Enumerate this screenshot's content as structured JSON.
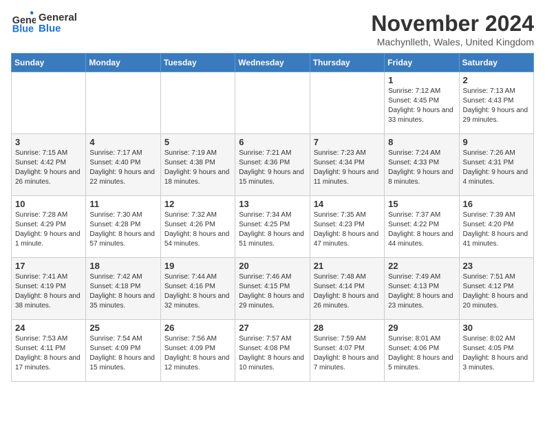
{
  "logo": {
    "line1": "General",
    "line2": "Blue"
  },
  "title": "November 2024",
  "location": "Machynlleth, Wales, United Kingdom",
  "weekdays": [
    "Sunday",
    "Monday",
    "Tuesday",
    "Wednesday",
    "Thursday",
    "Friday",
    "Saturday"
  ],
  "weeks": [
    [
      {
        "day": "",
        "info": ""
      },
      {
        "day": "",
        "info": ""
      },
      {
        "day": "",
        "info": ""
      },
      {
        "day": "",
        "info": ""
      },
      {
        "day": "",
        "info": ""
      },
      {
        "day": "1",
        "info": "Sunrise: 7:12 AM\nSunset: 4:45 PM\nDaylight: 9 hours and 33 minutes."
      },
      {
        "day": "2",
        "info": "Sunrise: 7:13 AM\nSunset: 4:43 PM\nDaylight: 9 hours and 29 minutes."
      }
    ],
    [
      {
        "day": "3",
        "info": "Sunrise: 7:15 AM\nSunset: 4:42 PM\nDaylight: 9 hours and 26 minutes."
      },
      {
        "day": "4",
        "info": "Sunrise: 7:17 AM\nSunset: 4:40 PM\nDaylight: 9 hours and 22 minutes."
      },
      {
        "day": "5",
        "info": "Sunrise: 7:19 AM\nSunset: 4:38 PM\nDaylight: 9 hours and 18 minutes."
      },
      {
        "day": "6",
        "info": "Sunrise: 7:21 AM\nSunset: 4:36 PM\nDaylight: 9 hours and 15 minutes."
      },
      {
        "day": "7",
        "info": "Sunrise: 7:23 AM\nSunset: 4:34 PM\nDaylight: 9 hours and 11 minutes."
      },
      {
        "day": "8",
        "info": "Sunrise: 7:24 AM\nSunset: 4:33 PM\nDaylight: 9 hours and 8 minutes."
      },
      {
        "day": "9",
        "info": "Sunrise: 7:26 AM\nSunset: 4:31 PM\nDaylight: 9 hours and 4 minutes."
      }
    ],
    [
      {
        "day": "10",
        "info": "Sunrise: 7:28 AM\nSunset: 4:29 PM\nDaylight: 9 hours and 1 minute."
      },
      {
        "day": "11",
        "info": "Sunrise: 7:30 AM\nSunset: 4:28 PM\nDaylight: 8 hours and 57 minutes."
      },
      {
        "day": "12",
        "info": "Sunrise: 7:32 AM\nSunset: 4:26 PM\nDaylight: 8 hours and 54 minutes."
      },
      {
        "day": "13",
        "info": "Sunrise: 7:34 AM\nSunset: 4:25 PM\nDaylight: 8 hours and 51 minutes."
      },
      {
        "day": "14",
        "info": "Sunrise: 7:35 AM\nSunset: 4:23 PM\nDaylight: 8 hours and 47 minutes."
      },
      {
        "day": "15",
        "info": "Sunrise: 7:37 AM\nSunset: 4:22 PM\nDaylight: 8 hours and 44 minutes."
      },
      {
        "day": "16",
        "info": "Sunrise: 7:39 AM\nSunset: 4:20 PM\nDaylight: 8 hours and 41 minutes."
      }
    ],
    [
      {
        "day": "17",
        "info": "Sunrise: 7:41 AM\nSunset: 4:19 PM\nDaylight: 8 hours and 38 minutes."
      },
      {
        "day": "18",
        "info": "Sunrise: 7:42 AM\nSunset: 4:18 PM\nDaylight: 8 hours and 35 minutes."
      },
      {
        "day": "19",
        "info": "Sunrise: 7:44 AM\nSunset: 4:16 PM\nDaylight: 8 hours and 32 minutes."
      },
      {
        "day": "20",
        "info": "Sunrise: 7:46 AM\nSunset: 4:15 PM\nDaylight: 8 hours and 29 minutes."
      },
      {
        "day": "21",
        "info": "Sunrise: 7:48 AM\nSunset: 4:14 PM\nDaylight: 8 hours and 26 minutes."
      },
      {
        "day": "22",
        "info": "Sunrise: 7:49 AM\nSunset: 4:13 PM\nDaylight: 8 hours and 23 minutes."
      },
      {
        "day": "23",
        "info": "Sunrise: 7:51 AM\nSunset: 4:12 PM\nDaylight: 8 hours and 20 minutes."
      }
    ],
    [
      {
        "day": "24",
        "info": "Sunrise: 7:53 AM\nSunset: 4:11 PM\nDaylight: 8 hours and 17 minutes."
      },
      {
        "day": "25",
        "info": "Sunrise: 7:54 AM\nSunset: 4:09 PM\nDaylight: 8 hours and 15 minutes."
      },
      {
        "day": "26",
        "info": "Sunrise: 7:56 AM\nSunset: 4:09 PM\nDaylight: 8 hours and 12 minutes."
      },
      {
        "day": "27",
        "info": "Sunrise: 7:57 AM\nSunset: 4:08 PM\nDaylight: 8 hours and 10 minutes."
      },
      {
        "day": "28",
        "info": "Sunrise: 7:59 AM\nSunset: 4:07 PM\nDaylight: 8 hours and 7 minutes."
      },
      {
        "day": "29",
        "info": "Sunrise: 8:01 AM\nSunset: 4:06 PM\nDaylight: 8 hours and 5 minutes."
      },
      {
        "day": "30",
        "info": "Sunrise: 8:02 AM\nSunset: 4:05 PM\nDaylight: 8 hours and 3 minutes."
      }
    ]
  ]
}
